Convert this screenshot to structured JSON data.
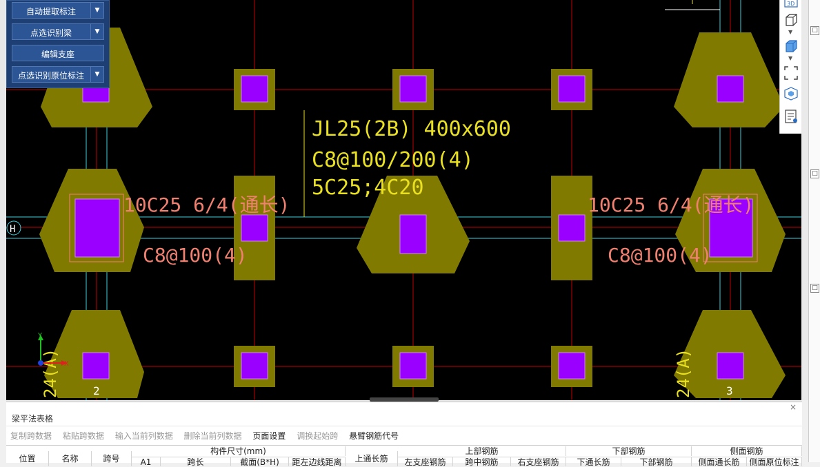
{
  "commands": [
    {
      "label": "自动提取标注",
      "dropdown": true
    },
    {
      "label": "点选识别梁",
      "dropdown": true
    },
    {
      "label": "编辑支座",
      "dropdown": false
    },
    {
      "label": "点选识别原位标注",
      "dropdown": true
    }
  ],
  "cad": {
    "beam_label": [
      "JL25(2B) 400x600",
      "C8@100/200(4)",
      "5C25;4C20"
    ],
    "left_rebar": "10C25 6/4(通长)",
    "right_rebar": "10C25 6/4(通长)",
    "left_stirrup": "C8@100(4)",
    "right_stirrup": "C8@100(4)",
    "axis_h": "H",
    "axis_2": "2",
    "axis_3": "3",
    "dim_left": "24(A)",
    "dim_right": "24(A)",
    "ucs_x": "X",
    "ucs_y": "Y"
  },
  "right_toolbar": {
    "icons": [
      "3d-icon",
      "cube-outline-icon",
      "cube-filled-icon",
      "crop-frame-icon",
      "box-view-icon",
      "properties-icon"
    ],
    "label_3d": "3D"
  },
  "right_panel": {
    "markers": [
      "□",
      "□",
      "□"
    ]
  },
  "table_panel": {
    "title": "梁平法表格",
    "close": "×",
    "toolbar": [
      {
        "label": "复制跨数据",
        "enabled": false
      },
      {
        "label": "粘贴跨数据",
        "enabled": false
      },
      {
        "label": "输入当前列数据",
        "enabled": false
      },
      {
        "label": "删除当前列数据",
        "enabled": false
      },
      {
        "label": "页面设置",
        "enabled": true
      },
      {
        "label": "调换起始跨",
        "enabled": false
      },
      {
        "label": "悬臂钢筋代号",
        "enabled": true
      }
    ],
    "headers_top": {
      "position": "位置",
      "name": "名称",
      "span_no": "跨号",
      "member_size": "构件尺寸(mm)",
      "top_through": "上通长筋",
      "top_rebar": "上部钢筋",
      "bottom_rebar": "下部钢筋",
      "side_rebar": "侧面钢筋"
    },
    "headers_sub": {
      "a1": "A1",
      "span_len": "跨长",
      "section": "截面(B*H)",
      "dist_edge": "距左边线距离",
      "left_support": "左支座钢筋",
      "mid_span": "跨中钢筋",
      "right_support": "右支座钢筋",
      "bottom_through": "下通长筋",
      "bottom_bar": "下部钢筋",
      "side_through": "侧面通长筋",
      "side_orig": "侧面原位标注"
    }
  },
  "colors": {
    "cad_bg": "#000000",
    "footing": "#807a00",
    "column": "#9a00ff",
    "grid_red": "#c00000",
    "grid_cyan": "#40d0e0",
    "beam_text": "#e8e020",
    "rebar_text": "#f08070",
    "panel_blue": "#1e3f73"
  }
}
